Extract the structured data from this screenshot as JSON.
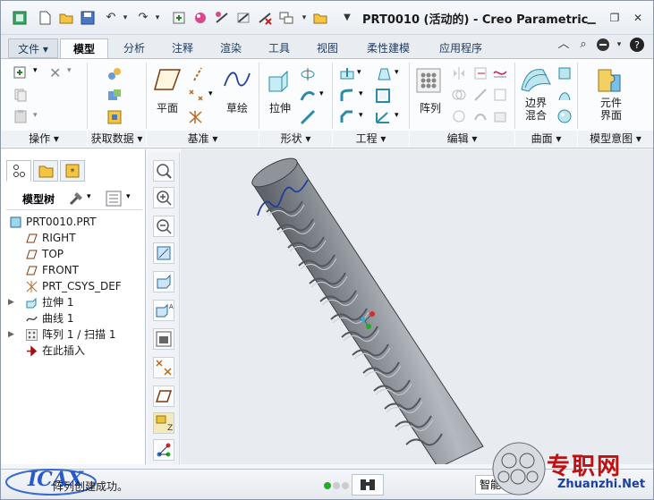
{
  "window": {
    "title": "PRT0010 (活动的) - Creo Parametric",
    "minimize_icon": "minimize-icon",
    "restore_icon": "restore-icon",
    "close_icon": "close-icon"
  },
  "quick_access": [
    "new-icon",
    "open-icon",
    "save-icon",
    "undo-icon",
    "redo-icon",
    "regenerate-icon",
    "windows-icon",
    "close-window-icon"
  ],
  "tabs": {
    "file": "文件",
    "items": [
      "模型",
      "分析",
      "注释",
      "渲染",
      "工具",
      "视图",
      "柔性建模",
      "应用程序"
    ],
    "active": "模型"
  },
  "ribbon": {
    "buttons": {
      "plane": "平面",
      "sketch": "草绘",
      "extrude": "拉伸",
      "pattern": "阵列",
      "boundary_blend": [
        "边界",
        "混合"
      ],
      "component_interface": [
        "元件",
        "界面"
      ]
    },
    "groups": [
      "操作",
      "获取数据",
      "基准",
      "形状",
      "工程",
      "编辑",
      "曲面",
      "模型意图"
    ]
  },
  "model_tree": {
    "header": "模型树",
    "items": [
      {
        "label": "PRT0010.PRT",
        "icon": "part-icon",
        "expandable": false
      },
      {
        "label": "RIGHT",
        "icon": "datum-plane-icon",
        "expandable": false
      },
      {
        "label": "TOP",
        "icon": "datum-plane-icon",
        "expandable": false
      },
      {
        "label": "FRONT",
        "icon": "datum-plane-icon",
        "expandable": false
      },
      {
        "label": "PRT_CSYS_DEF",
        "icon": "csys-icon",
        "expandable": false
      },
      {
        "label": "拉伸 1",
        "icon": "extrude-icon",
        "expandable": true
      },
      {
        "label": "曲线 1",
        "icon": "curve-icon",
        "expandable": false
      },
      {
        "label": "阵列 1 / 扫描 1",
        "icon": "pattern-icon",
        "expandable": true
      },
      {
        "label": "在此插入",
        "icon": "insert-here-icon",
        "expandable": false
      }
    ]
  },
  "status": {
    "message": "阵列创建成功。",
    "filter_value": "智能"
  },
  "watermark": {
    "site_cn": "专职网",
    "site_url": "Zhuanzhi.Net",
    "logo_text": "ICAX"
  },
  "colors": {
    "accent": "#1f3a5f",
    "model_gray": "#8a8f96",
    "curve_blue": "#1f3f9a",
    "watermark_red": "#c01010"
  }
}
